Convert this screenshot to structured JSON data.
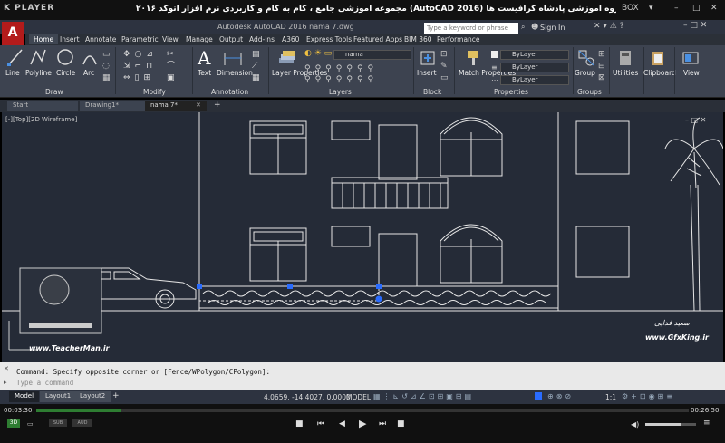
{
  "player": {
    "logo": "K PLAYER",
    "video_title": "مجموعه آموزشی جامع ، گام به گام و کاربردی نرم افزار اتوکد ۲۰۱۶ (AutoCAD 2016) مدرس : سعید فدایی (تیچرمن) گروه آموزشی پادشاه گرافیست ها",
    "box_label": "BOX",
    "time_elapsed": "00:03:30",
    "time_total": "00:26:50",
    "progress_fraction": 0.13
  },
  "acad": {
    "logo": "A",
    "doc_title": "Autodesk AutoCAD 2016    nama 7.dwg",
    "search_placeholder": "Type a keyword or phrase",
    "sign_in": "Sign In",
    "tabs": [
      "Home",
      "Insert",
      "Annotate",
      "Parametric",
      "View",
      "Manage",
      "Output",
      "Add-ins",
      "A360",
      "Express Tools",
      "Featured Apps",
      "BIM 360",
      "Performance"
    ],
    "draw_tools": [
      "Line",
      "Polyline",
      "Circle",
      "Arc"
    ],
    "tools": {
      "text": "Text",
      "dimension": "Dimension",
      "layer_properties": "Layer Properties",
      "insert": "Insert",
      "match_properties": "Match Properties",
      "group": "Group",
      "utilities": "Utilities",
      "clipboard": "Clipboard",
      "view": "View"
    },
    "layer_dropdown": "nama",
    "bylayer": [
      "ByLayer",
      "ByLayer",
      "ByLayer"
    ],
    "panel_titles": {
      "draw": "Draw",
      "modify": "Modify",
      "annotation": "Annotation",
      "layers": "Layers",
      "block": "Block",
      "properties": "Properties",
      "groups": "Groups"
    },
    "file_tabs": [
      "Start",
      "Drawing1*",
      "nama 7*"
    ],
    "viewport_label": "[-][Top][2D Wireframe]",
    "command_history": "Command: Specify opposite corner or [Fence/WPolygon/CPolygon]:",
    "command_placeholder": "Type a command",
    "layout_tabs": [
      "Model",
      "Layout1",
      "Layout2"
    ],
    "coords": "4.0659, -14.4027, 0.0000",
    "status_model": "MODEL",
    "scale": "1:1"
  },
  "watermarks": {
    "left_site": "www.TeacherMan.ir",
    "right_site": "www.GfxKing.ir",
    "right_name": "سعید فدایی"
  },
  "colors": {
    "drawing_bg": "#252b37",
    "linework": "#e6e6e6",
    "grip": "#2a6cff"
  }
}
